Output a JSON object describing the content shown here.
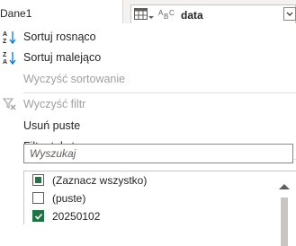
{
  "topbar": {
    "sheet_name": "Dane1",
    "column": {
      "type_symbol": "ABC",
      "name": "data"
    }
  },
  "menu": {
    "items": [
      {
        "label": "Sortuj rosnąco",
        "icon": "sort-ascending-icon",
        "enabled": true
      },
      {
        "label": "Sortuj malejąco",
        "icon": "sort-descending-icon",
        "enabled": true
      },
      {
        "label": "Wyczyść sortowanie",
        "icon": "",
        "enabled": false
      },
      {
        "label": "Wyczyść filtr",
        "icon": "clear-filter-icon",
        "enabled": false
      },
      {
        "label": "Usuń puste",
        "icon": "",
        "enabled": true
      },
      {
        "label": "Filtry tekstu",
        "icon": "",
        "enabled": true,
        "submenu": true
      }
    ]
  },
  "search": {
    "placeholder": "Wyszukaj",
    "value": ""
  },
  "values": {
    "items": [
      {
        "label": "(Zaznacz wszystko)",
        "state": "partial"
      },
      {
        "label": "(puste)",
        "state": "unchecked"
      },
      {
        "label": "20250102",
        "state": "checked"
      }
    ]
  },
  "colors": {
    "accent_green": "#217346",
    "sort_icon_blue": "#0078d4",
    "disabled_text": "#a19f9d",
    "text": "#252423"
  }
}
